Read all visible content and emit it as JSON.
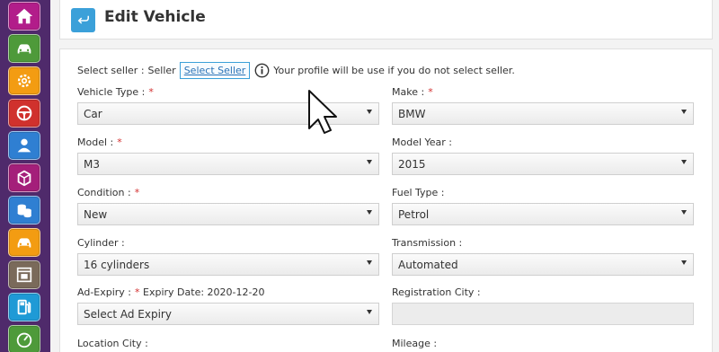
{
  "colors": {
    "sidebar_bg": "#4f2a6b",
    "accent": "#3ba0d9",
    "required": "#d32f2f"
  },
  "sidebar": {
    "items": [
      {
        "icon": "home-icon",
        "color": "#b21d8a"
      },
      {
        "icon": "car-icon",
        "color": "#4e9a3a"
      },
      {
        "icon": "gear-icon",
        "color": "#f39c12"
      },
      {
        "icon": "steering-wheel-icon",
        "color": "#d0312d"
      },
      {
        "icon": "user-icon",
        "color": "#2f7fd2"
      },
      {
        "icon": "box-icon",
        "color": "#a41f7a"
      },
      {
        "icon": "coins-icon",
        "color": "#2f7fd2"
      },
      {
        "icon": "car-icon",
        "color": "#f39c12"
      },
      {
        "icon": "ad-window-icon",
        "color": "#7a6a5a"
      },
      {
        "icon": "fuel-pump-icon",
        "color": "#1f9ad6"
      },
      {
        "icon": "speedometer-icon",
        "color": "#4e9a3a"
      }
    ]
  },
  "header": {
    "title": "Edit Vehicle"
  },
  "seller": {
    "label": "Select seller :",
    "value": "Seller",
    "link": "Select Seller",
    "note": "Your profile will be use if you do not select seller."
  },
  "fields": {
    "vehicle_type": {
      "label": "Vehicle Type :",
      "required": "*",
      "value": "Car"
    },
    "make": {
      "label": "Make :",
      "required": "*",
      "value": "BMW"
    },
    "model": {
      "label": "Model :",
      "required": "*",
      "value": "M3"
    },
    "model_year": {
      "label": "Model Year :",
      "value": "2015"
    },
    "condition": {
      "label": "Condition :",
      "required": "*",
      "value": "New"
    },
    "fuel_type": {
      "label": "Fuel Type :",
      "value": "Petrol"
    },
    "cylinder": {
      "label": "Cylinder :",
      "value": "16 cylinders"
    },
    "transmission": {
      "label": "Transmission :",
      "value": "Automated"
    },
    "ad_expiry": {
      "label": "Ad-Expiry :",
      "required": "*",
      "note": "Expiry Date: 2020-12-20",
      "value": "Select Ad Expiry"
    },
    "registration_city": {
      "label": "Registration City :",
      "value": ""
    },
    "location_city": {
      "label": "Location City :"
    },
    "mileage": {
      "label": "Mileage :"
    }
  }
}
